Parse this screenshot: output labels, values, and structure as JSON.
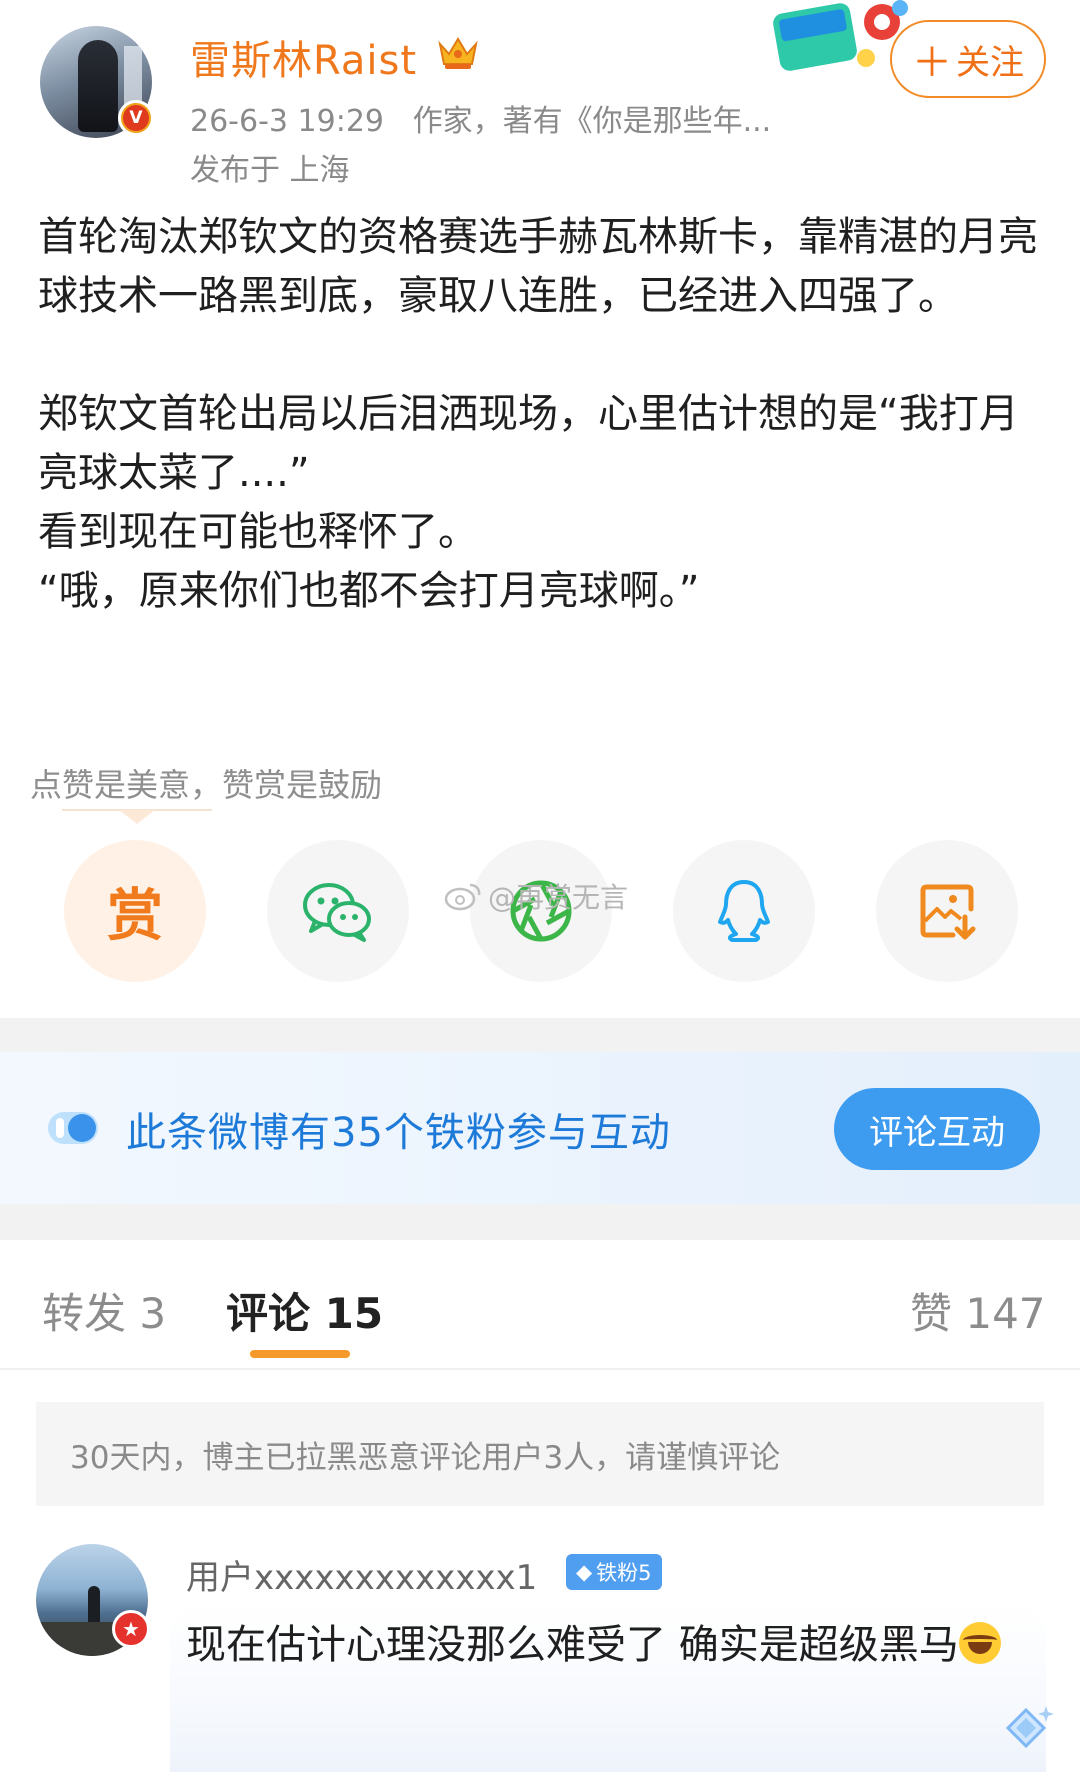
{
  "header": {
    "username": "雷斯林Raist",
    "timestamp": "26-6-3 19:29",
    "bio": "作家，著有《你是那些年...",
    "location": "发布于 上海",
    "follow_label": "关注",
    "verified_mark": "V"
  },
  "post": {
    "paragraph1": "首轮淘汰郑钦文的资格赛选手赫瓦林斯卡，靠精湛的月亮球技术一路黑到底，豪取八连胜，已经进入四强了。",
    "paragraph2_line1": "郑钦文首轮出局以后泪洒现场，心里估计想的是“我打月亮球太菜了....”",
    "paragraph2_line2": "看到现在可能也释怀了。",
    "paragraph2_line3": "“哦，原来你们也都不会打月亮球啊。”"
  },
  "reward": {
    "hint": "点赞是美意，赞赏是鼓励",
    "reward_char": "赏",
    "share_targets": [
      "reward",
      "wechat-icon",
      "moments-icon",
      "qq-icon",
      "save-image-icon"
    ],
    "watermark": "@再赏无言"
  },
  "fan_banner": {
    "text": "此条微博有35个铁粉参与互动",
    "button_label": "评论互动"
  },
  "tabs": {
    "repost": "转发 3",
    "comments": "评论 15",
    "likes": "赞 147"
  },
  "notice": "30天内，博主已拉黑恶意评论用户3人，请谨慎评论",
  "comment": {
    "username": "用户xxxxxxxxxxxxx1",
    "fan_badge": "铁粉5",
    "text": "现在估计心理没那么难受了 确实是超级黑马"
  },
  "colors": {
    "brand_orange": "#f07018",
    "link_blue": "#1d7ad8",
    "button_blue": "#3d9bf0",
    "tab_underline": "#f59a2a"
  }
}
